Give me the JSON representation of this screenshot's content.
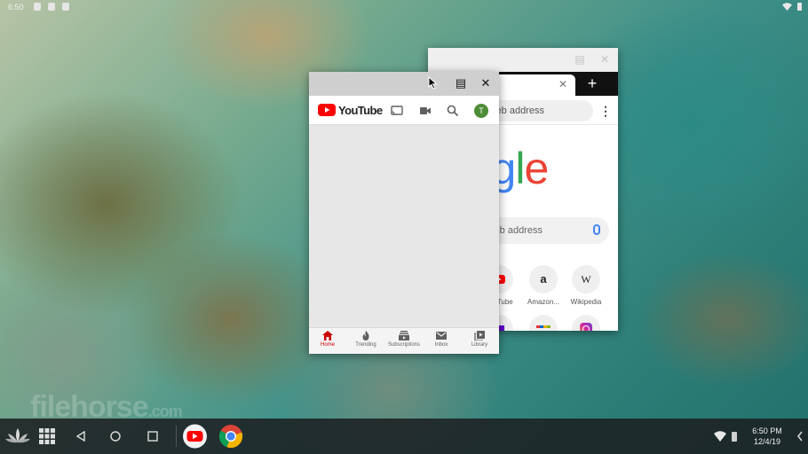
{
  "status_bar": {
    "time": "6:50"
  },
  "chrome_window": {
    "omnibox_placeholder": "Search or type web address",
    "logo_text": "Google",
    "search_placeholder": "Search or type web address",
    "tiles": [
      {
        "label": "YouTube"
      },
      {
        "label": "Amazon..."
      },
      {
        "label": "Wikipedia"
      }
    ]
  },
  "youtube_window": {
    "logo_text": "YouTube",
    "avatar_initial": "T",
    "nav": [
      {
        "label": "Home"
      },
      {
        "label": "Trending"
      },
      {
        "label": "Subscriptions"
      },
      {
        "label": "Inbox"
      },
      {
        "label": "Library"
      }
    ]
  },
  "watermark": {
    "text": "filehorse",
    "suffix": ".com"
  },
  "taskbar": {
    "time": "6:50 PM",
    "date": "12/4/19"
  },
  "colors": {
    "youtube_red": "#ff0000",
    "active_nav": "#cc0000",
    "google_blue": "#4285f4",
    "google_red": "#ea4335",
    "google_yellow": "#fbbc05",
    "google_green": "#34a853",
    "avatar": "#4c8c36"
  }
}
